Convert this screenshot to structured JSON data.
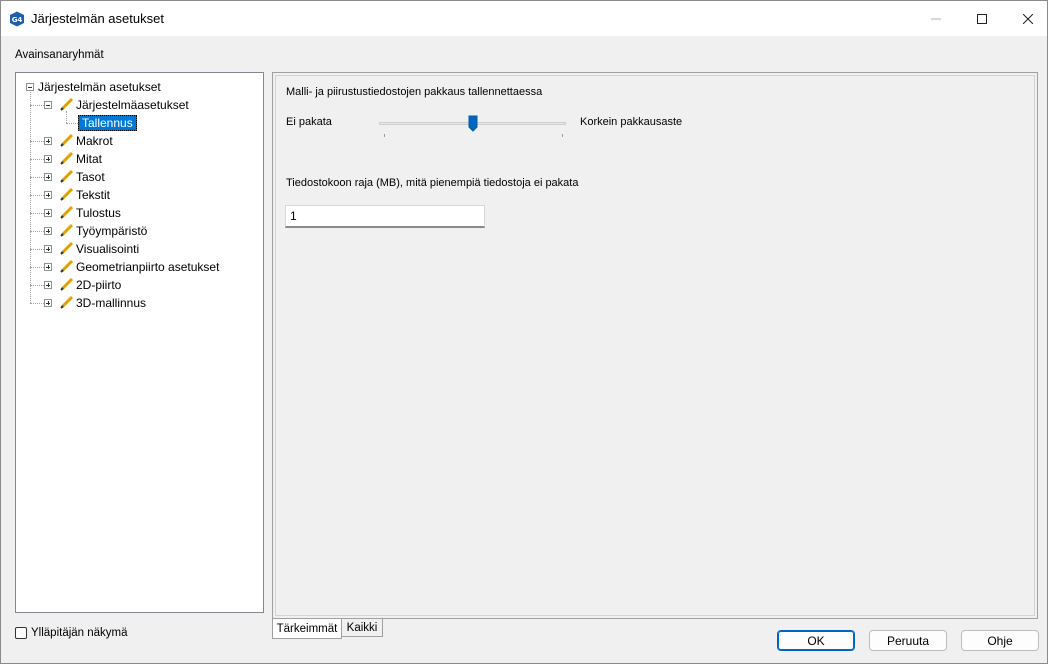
{
  "window": {
    "title": "Järjestelmän asetukset",
    "app_icon_text": "G4",
    "accent_color": "#0067c0"
  },
  "group_label": "Avainsanaryhmät",
  "tree": {
    "root": "Järjestelmän asetukset",
    "expanded_item": "Järjestelmäasetukset",
    "selected_child": "Tallennus",
    "items": [
      "Makrot",
      "Mitat",
      "Tasot",
      "Tekstit",
      "Tulostus",
      "Työympäristö",
      "Visualisointi",
      "Geometrianpiirto asetukset",
      "2D-piirto",
      "3D-mallinnus"
    ]
  },
  "settings": {
    "compression_title": "Malli- ja piirustustiedostojen pakkaus tallennettaessa",
    "slider_min_label": "Ei pakata",
    "slider_max_label": "Korkein pakkausaste",
    "slider_value_fraction": 0.5,
    "size_limit_label": "Tiedostokoon raja (MB), mitä pienempiä tiedostoja ei pakata",
    "size_limit_value": "1"
  },
  "tabs": {
    "important": "Tärkeimmät",
    "all": "Kaikki"
  },
  "admin_view_label": "Ylläpitäjän näkymä",
  "buttons": {
    "ok": "OK",
    "cancel": "Peruuta",
    "help": "Ohje"
  }
}
